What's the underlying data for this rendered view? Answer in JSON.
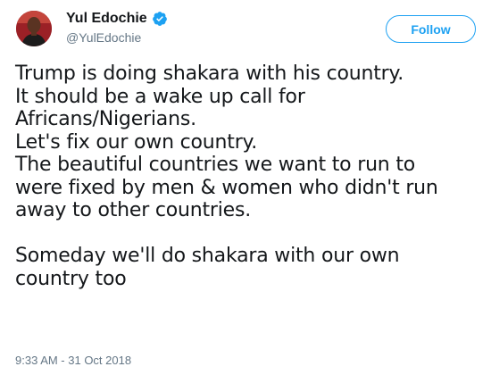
{
  "author": {
    "display_name": "Yul Edochie",
    "handle": "@YulEdochie",
    "verified": true,
    "avatar_icon": "avatar-photo-icon",
    "verified_icon": "verified-badge-icon"
  },
  "actions": {
    "follow_label": "Follow"
  },
  "tweet": {
    "lines": [
      "Trump is doing shakara with his country.",
      "It should be a wake up call for",
      "Africans/Nigerians.",
      "Let's fix our own country.",
      "The beautiful countries we want to run to",
      "were fixed by men & women who didn't run",
      "away to other countries.",
      "",
      "Someday we'll do shakara with our own",
      "country too"
    ],
    "timestamp": "9:33 AM - 31 Oct 2018"
  },
  "colors": {
    "accent": "#1da1f2",
    "text": "#14171a",
    "secondary": "#657786"
  }
}
